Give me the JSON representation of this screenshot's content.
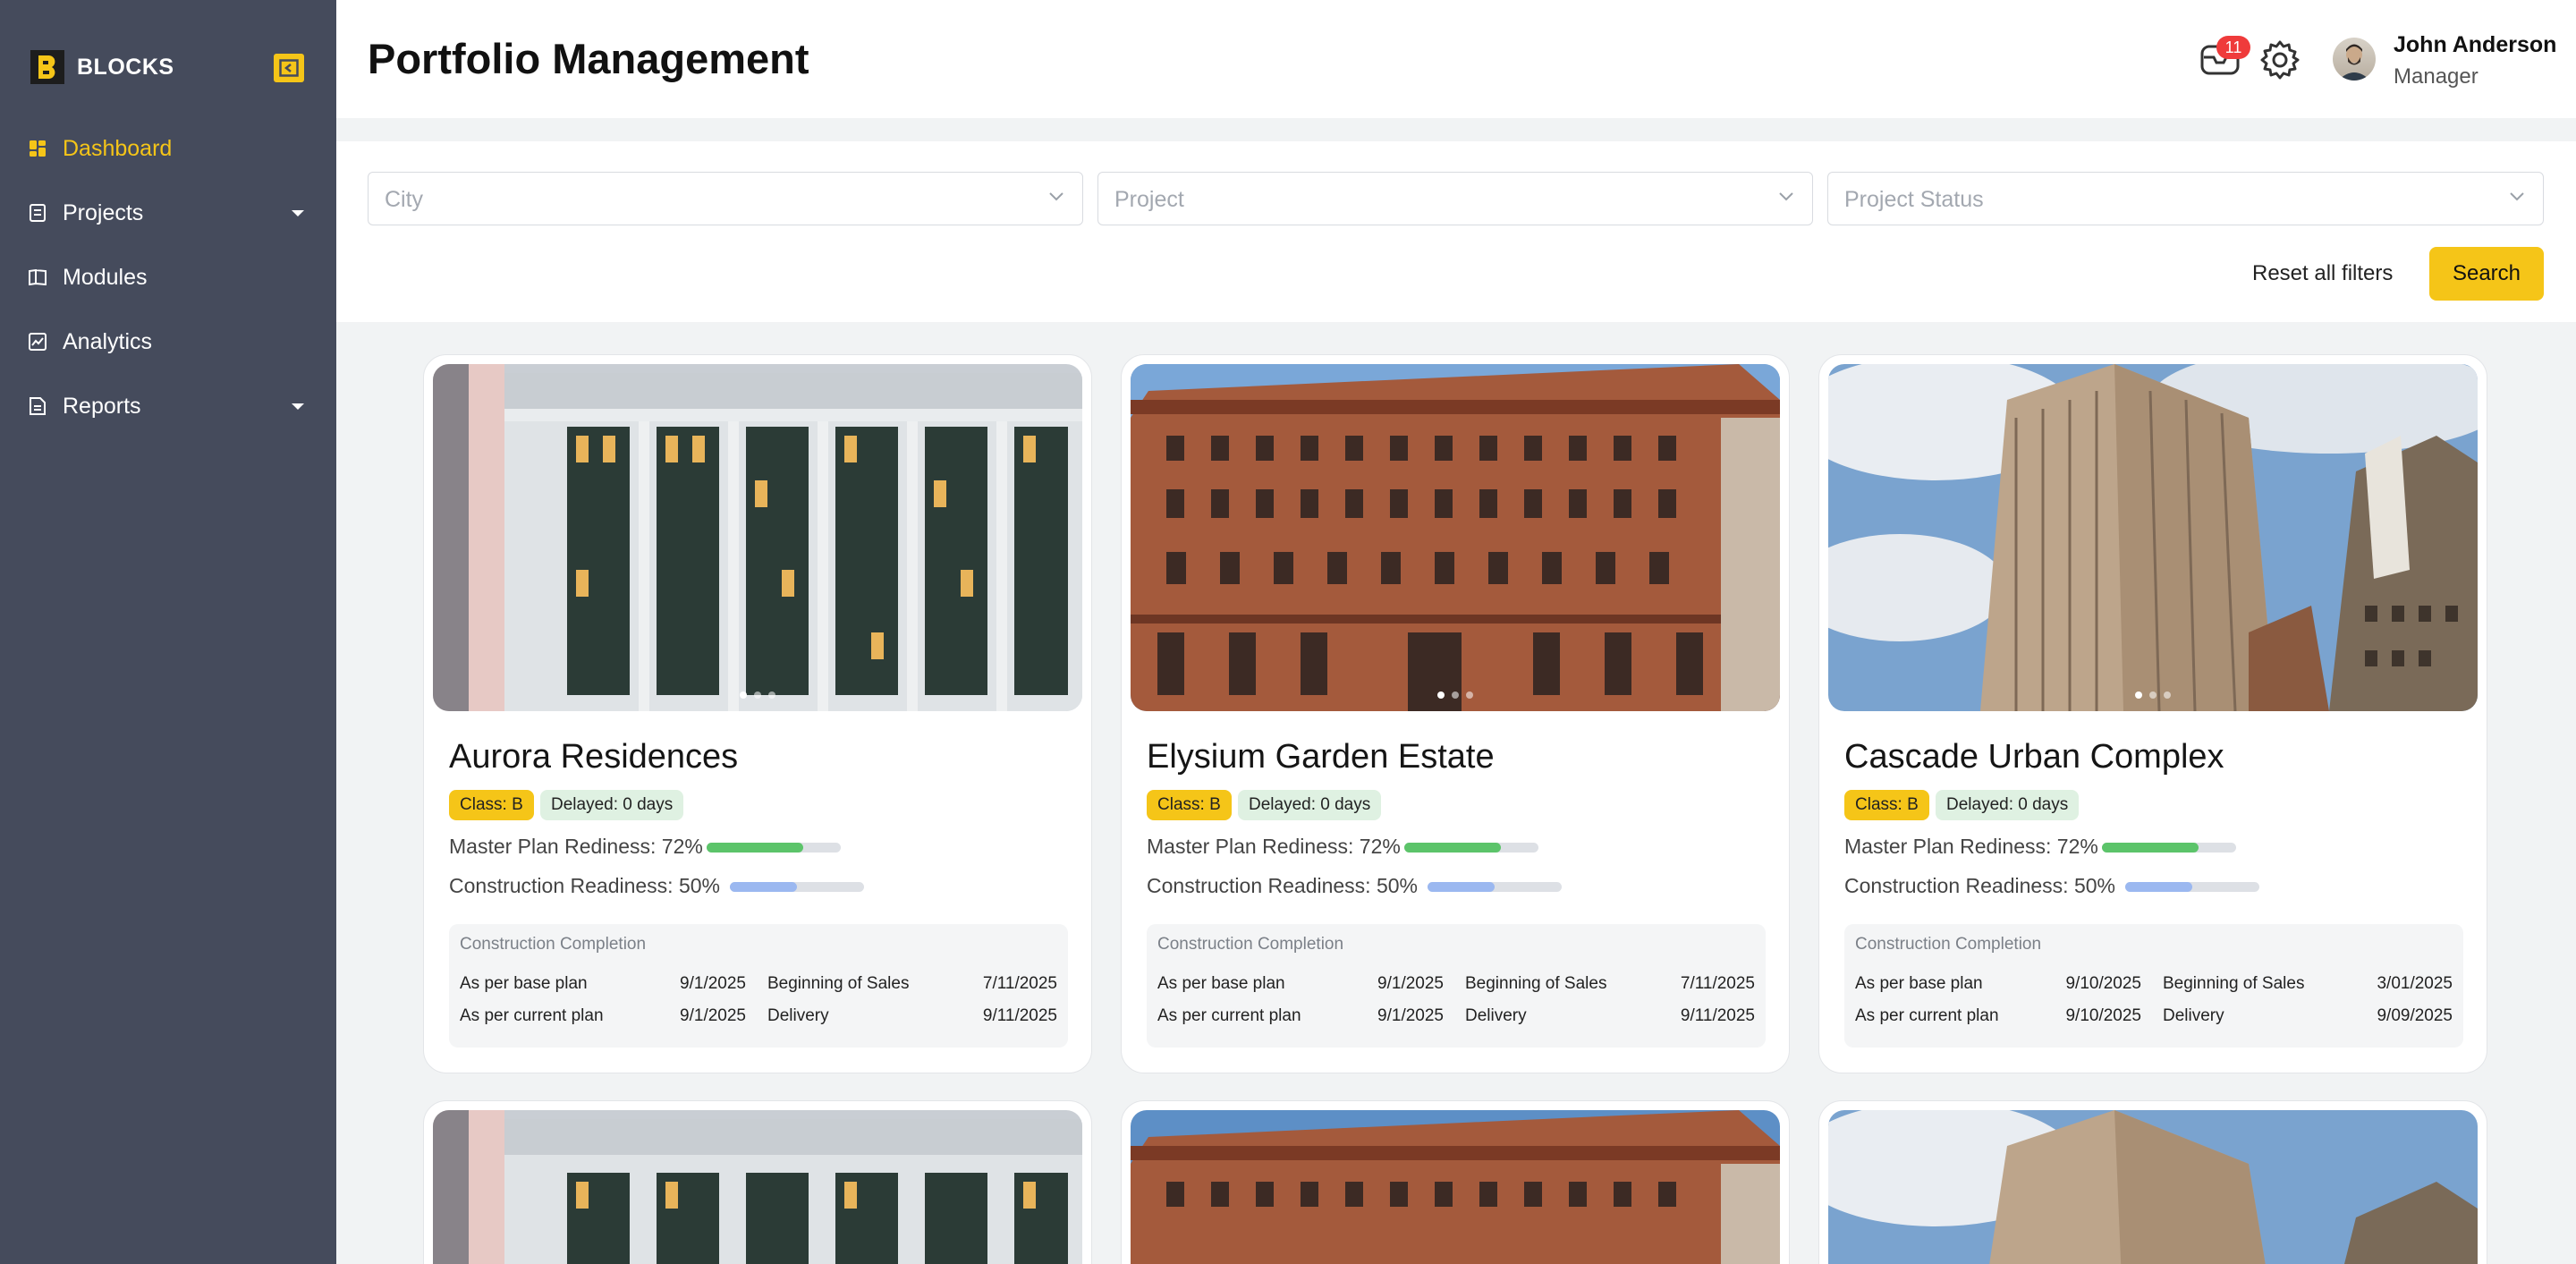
{
  "sidebar": {
    "brand": "BLOCKS",
    "items": [
      {
        "label": "Dashboard",
        "icon": "dashboard-icon",
        "active": true
      },
      {
        "label": "Projects",
        "icon": "projects-icon",
        "has_submenu": true
      },
      {
        "label": "Modules",
        "icon": "modules-icon"
      },
      {
        "label": "Analytics",
        "icon": "analytics-icon"
      },
      {
        "label": "Reports",
        "icon": "reports-icon",
        "has_submenu": true
      }
    ]
  },
  "header": {
    "title": "Portfolio Management",
    "notification_count": "11",
    "user": {
      "name": "John Anderson",
      "role": "Manager"
    }
  },
  "filters": {
    "city_placeholder": "City",
    "project_placeholder": "Project",
    "status_placeholder": "Project Status",
    "reset_label": "Reset all filters",
    "search_label": "Search"
  },
  "colors": {
    "accent": "#f5c518",
    "sidebar": "#454b5c",
    "progress_green": "#5cc46a",
    "progress_blue": "#9bb8f0"
  },
  "cards": [
    {
      "name": "Aurora Residences",
      "class": "Class: B",
      "delayed": "Delayed: 0 days",
      "master_plan": "Master Plan Rediness: 72%",
      "master_plan_value": 72,
      "construction": "Construction Readiness: 50%",
      "construction_value": 50,
      "completion_title": "Construction Completion",
      "rows": [
        {
          "label": "As per base plan",
          "date": "9/1/2025",
          "label2": "Beginning of Sales",
          "date2": "7/11/2025"
        },
        {
          "label": "As per current plan",
          "date": "9/1/2025",
          "label2": "Delivery",
          "date2": "9/11/2025"
        }
      ]
    },
    {
      "name": "Elysium Garden Estate",
      "class": "Class: B",
      "delayed": "Delayed: 0 days",
      "master_plan": "Master Plan Rediness: 72%",
      "master_plan_value": 72,
      "construction": "Construction Readiness: 50%",
      "construction_value": 50,
      "completion_title": "Construction Completion",
      "rows": [
        {
          "label": "As per base plan",
          "date": "9/1/2025",
          "label2": "Beginning of Sales",
          "date2": "7/11/2025"
        },
        {
          "label": "As per current plan",
          "date": "9/1/2025",
          "label2": "Delivery",
          "date2": "9/11/2025"
        }
      ]
    },
    {
      "name": "Cascade Urban Complex",
      "class": "Class: B",
      "delayed": "Delayed: 0 days",
      "master_plan": "Master Plan Rediness: 72%",
      "master_plan_value": 72,
      "construction": "Construction Readiness: 50%",
      "construction_value": 50,
      "completion_title": "Construction Completion",
      "rows": [
        {
          "label": "As per base plan",
          "date": "9/10/2025",
          "label2": "Beginning of Sales",
          "date2": "3/01/2025"
        },
        {
          "label": "As per current plan",
          "date": "9/10/2025",
          "label2": "Delivery",
          "date2": "9/09/2025"
        }
      ]
    }
  ]
}
